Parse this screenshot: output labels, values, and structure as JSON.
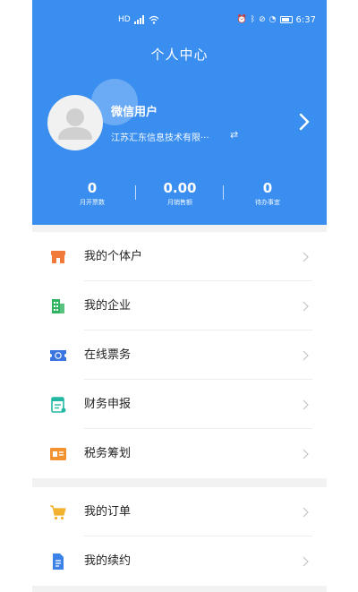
{
  "status_bar": {
    "left_icons": [
      "hd-icon",
      "signal-icon",
      "wifi-icon"
    ],
    "right_icons": [
      "alarm-icon",
      "bluetooth-icon",
      "mute-icon",
      "speed-icon",
      "battery-icon"
    ],
    "time": "6:37"
  },
  "header": {
    "title": "个人中心",
    "user_name": "微信用户",
    "company": "江苏汇东信息技术有限···",
    "switch_glyph": "⇄"
  },
  "stats": [
    {
      "value": "0",
      "label": "月开票数"
    },
    {
      "value": "0.00",
      "label": "月销售额"
    },
    {
      "value": "0",
      "label": "待办事宜"
    }
  ],
  "menu_group_1": [
    {
      "label": "我的个体户",
      "icon": "store-icon",
      "color": "#f07a3a"
    },
    {
      "label": "我的企业",
      "icon": "building-icon",
      "color": "#2fb35e"
    },
    {
      "label": "在线票务",
      "icon": "ticket-icon",
      "color": "#3a74e0"
    },
    {
      "label": "财务申报",
      "icon": "report-icon",
      "color": "#22b8a4"
    },
    {
      "label": "税务筹划",
      "icon": "tax-card-icon",
      "color": "#f2932f"
    }
  ],
  "menu_group_2": [
    {
      "label": "我的订单",
      "icon": "cart-icon",
      "color": "#f2b22f"
    },
    {
      "label": "我的续约",
      "icon": "contract-doc-icon",
      "color": "#3a82e8"
    }
  ],
  "colors": {
    "header_blue": "#3a8ef0",
    "page_bg": "#f2f2f2",
    "chevron": "#c4c4c4"
  }
}
